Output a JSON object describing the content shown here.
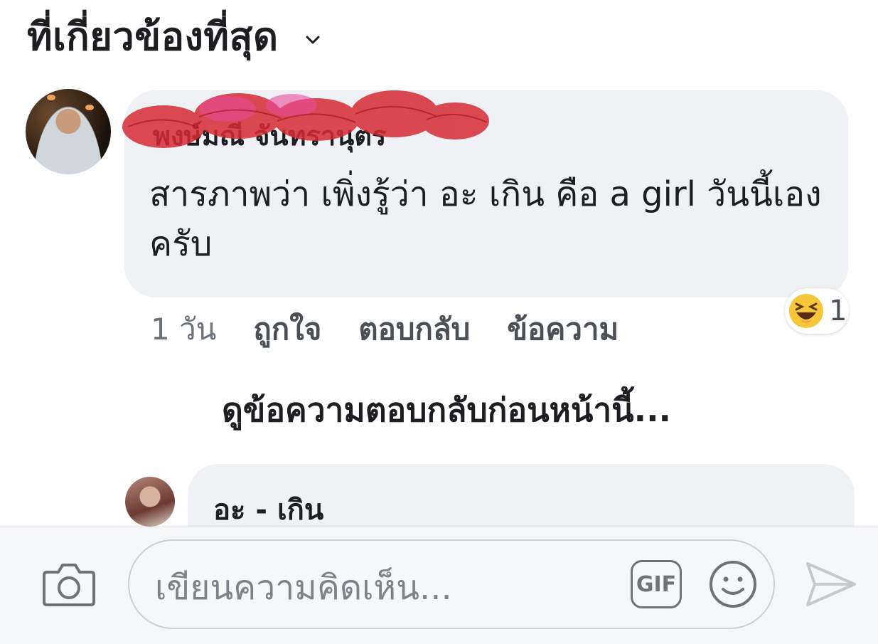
{
  "header": {
    "title": "ที่เกี่ยวข้องที่สุด",
    "chevron_icon": "chevron-down-icon"
  },
  "comments": [
    {
      "author": "พงษ์มณี จันทรานุตร",
      "text": "สารภาพว่า เพิ่งรู้ว่า อะ เกิน คือ a girl วันนี้เองครับ",
      "time": "1 วัน",
      "actions": [
        "ถูกใจ",
        "ตอบกลับ",
        "ข้อความ"
      ],
      "reaction": {
        "icon": "haha-emoji-icon",
        "count": "1"
      }
    }
  ],
  "view_previous_replies": "ดูข้อความตอบกลับก่อนหน้านี้...",
  "reply": {
    "author": "อะ - เกิน"
  },
  "composer": {
    "placeholder": "เขียนความคิดเห็น...",
    "gif_label": "GIF",
    "camera_icon": "camera-icon",
    "emoji_icon": "emoji-icon",
    "send_icon": "send-icon"
  },
  "colors": {
    "bubble": "#f0f1f5",
    "text": "#1c1e21",
    "muted": "#4b4f56",
    "redaction": "#d62b35"
  }
}
